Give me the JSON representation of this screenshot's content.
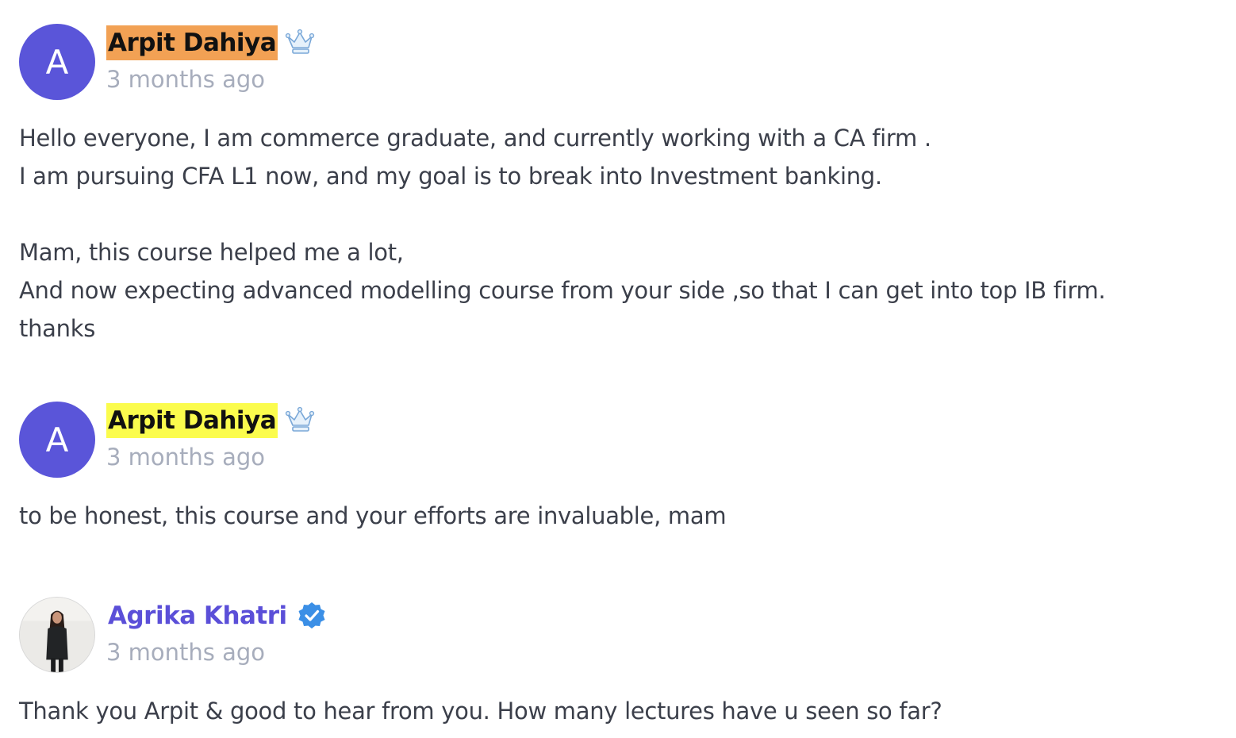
{
  "comments": [
    {
      "avatar_letter": "A",
      "name": "Arpit Dahiya",
      "name_highlight": "#f2a154",
      "badge": "crown-icon",
      "time": "3 months ago",
      "text": "Hello everyone, I am commerce graduate, and currently working with a CA firm .\nI am pursuing CFA L1 now, and my goal is to break into Investment banking.\n\nMam, this course helped me a lot,\nAnd now expecting advanced modelling course from your side ,so that I can get into top IB firm.\nthanks"
    },
    {
      "avatar_letter": "A",
      "name": "Arpit Dahiya",
      "name_highlight": "#fbfc4d",
      "badge": "crown-icon",
      "time": "3 months ago",
      "text": "to be honest, this course and your efforts are invaluable, mam"
    },
    {
      "avatar": "profile-photo",
      "name": "Agrika Khatri",
      "name_color": "#5b4fd8",
      "badge": "verified-icon",
      "time": "3 months ago",
      "text": "Thank you Arpit & good to hear from you. How many lectures have u seen so far?"
    }
  ],
  "colors": {
    "avatar_bg": "#5a55d9",
    "timestamp": "#a7adbc",
    "body_text": "#3b3f4a",
    "verified": "#3b8fe6"
  }
}
